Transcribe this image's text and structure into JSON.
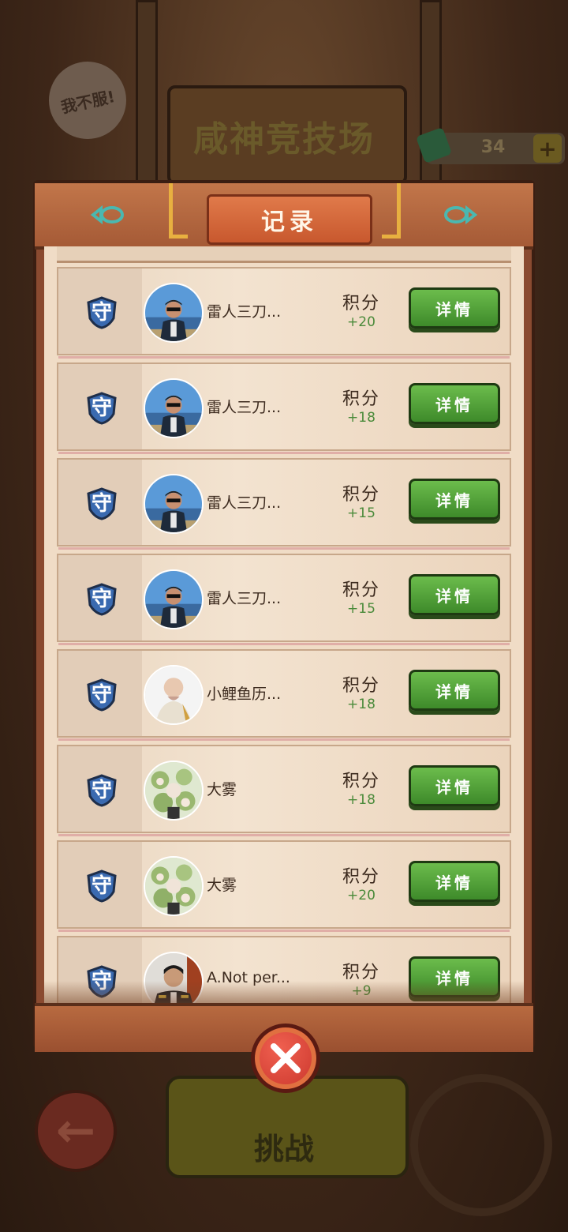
{
  "background": {
    "bubble_text": "我不服!",
    "arena_title": "咸神竞技场",
    "coin_count": "34",
    "plus_label": "+",
    "challenge_label": "挑战"
  },
  "modal": {
    "title": "记录",
    "role_label": "守",
    "score_label": "积分",
    "detail_label": "详情",
    "records": [
      {
        "name": "雷人三刀...",
        "score": "+20",
        "avatar": "avatar-man-sunglasses"
      },
      {
        "name": "雷人三刀...",
        "score": "+18",
        "avatar": "avatar-man-sunglasses"
      },
      {
        "name": "雷人三刀...",
        "score": "+15",
        "avatar": "avatar-man-sunglasses"
      },
      {
        "name": "雷人三刀...",
        "score": "+15",
        "avatar": "avatar-man-sunglasses"
      },
      {
        "name": "小鲤鱼历...",
        "score": "+18",
        "avatar": "avatar-bald-figure"
      },
      {
        "name": "大雾",
        "score": "+18",
        "avatar": "avatar-anime-group"
      },
      {
        "name": "大雾",
        "score": "+20",
        "avatar": "avatar-anime-group"
      },
      {
        "name": "A.Not per...",
        "score": "+9",
        "avatar": "avatar-man-uniform"
      }
    ]
  },
  "colors": {
    "accent_green": "#4a8a3a",
    "button_green": "#5aa83c",
    "close_red": "#d8402e",
    "role_blue": "#3a6ab0"
  }
}
